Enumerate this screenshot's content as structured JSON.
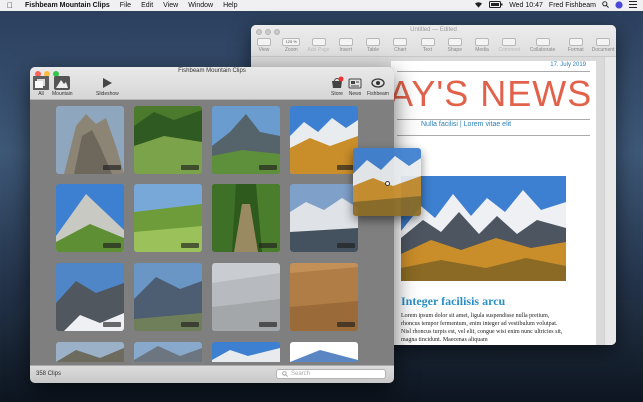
{
  "menubar": {
    "app_name": "Fishbeam Mountain Clips",
    "menus": [
      "File",
      "Edit",
      "View",
      "Window",
      "Help"
    ],
    "clock": "Wed 10:47",
    "user": "Fred Fishbeam"
  },
  "pages": {
    "title": "Untitled — Edited",
    "tools": [
      {
        "label": "View",
        "icon": "view-icon"
      },
      {
        "label": "Zoom",
        "icon": "zoom-icon",
        "value": "125 %"
      },
      {
        "label": "Add Page",
        "icon": "add-page-icon"
      },
      {
        "label": "Insert",
        "icon": "insert-icon"
      },
      {
        "label": "Table",
        "icon": "table-icon"
      },
      {
        "label": "Chart",
        "icon": "chart-icon"
      },
      {
        "label": "Text",
        "icon": "text-icon"
      },
      {
        "label": "Shape",
        "icon": "shape-icon"
      },
      {
        "label": "Media",
        "icon": "media-icon"
      },
      {
        "label": "Comment",
        "icon": "comment-icon"
      },
      {
        "label": "Collaborate",
        "icon": "collaborate-icon"
      },
      {
        "label": "Format",
        "icon": "format-icon"
      },
      {
        "label": "Document",
        "icon": "document-icon"
      }
    ],
    "doc": {
      "date": "17. July 2019",
      "headline": "AY'S NEWS",
      "subheading": "Nulla facilisi | Lorem vitae elit",
      "heading2": "Integer facilisis arcu",
      "paragraph": "Lorem ipsum dolor sit amet, ligula suspendisse nulla pretium, rhoncus tempor fermentum, enim integer ad vestibulum volutpat. Nisl rhoncus turpis est, vel elit, congue wisi enim nunc ultricies sit, magna tincidunt. Maecenas aliquam"
    }
  },
  "photos": {
    "title": "Fishbeam Mountain Clips",
    "toolbar": {
      "all": "All",
      "mountain": "Mountain",
      "slideshow": "Slideshow",
      "store": "Store",
      "news": "News",
      "fishbeam": "Fishbeam"
    },
    "clip_count": "358 Clips",
    "search_placeholder": "Search"
  },
  "colors": {
    "accent_blue": "#2a7fb5",
    "headline_red": "#e2614a",
    "tile_sky": "#3a78c8",
    "tile_grass": "#5a8a2a"
  }
}
